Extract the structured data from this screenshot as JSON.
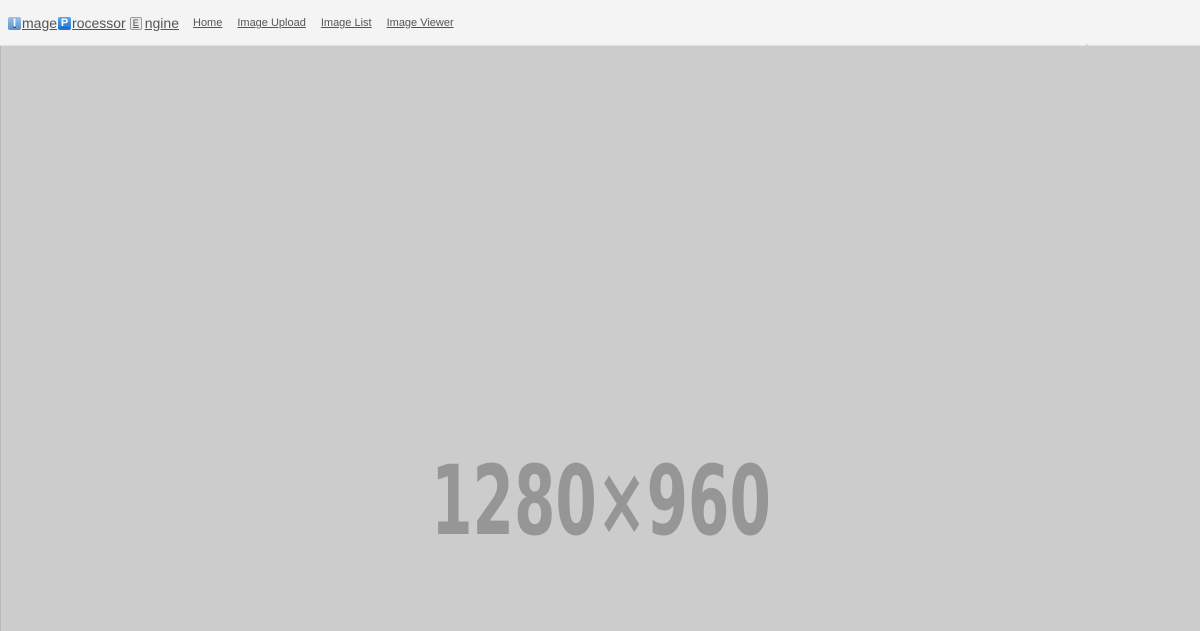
{
  "app": {
    "brand": {
      "badge_i": "I",
      "text_i": "mage",
      "badge_p": "P",
      "text_p": "rocessor",
      "badge_e": "E",
      "text_e": "ngine"
    }
  },
  "nav": {
    "items": [
      {
        "label": "Home"
      },
      {
        "label": "Image Upload"
      },
      {
        "label": "Image List"
      },
      {
        "label": "Image Viewer"
      }
    ]
  },
  "main": {
    "placeholder_label": "1280×960",
    "placeholder_color": "#cccccc",
    "placeholder_text_color": "#969696"
  }
}
